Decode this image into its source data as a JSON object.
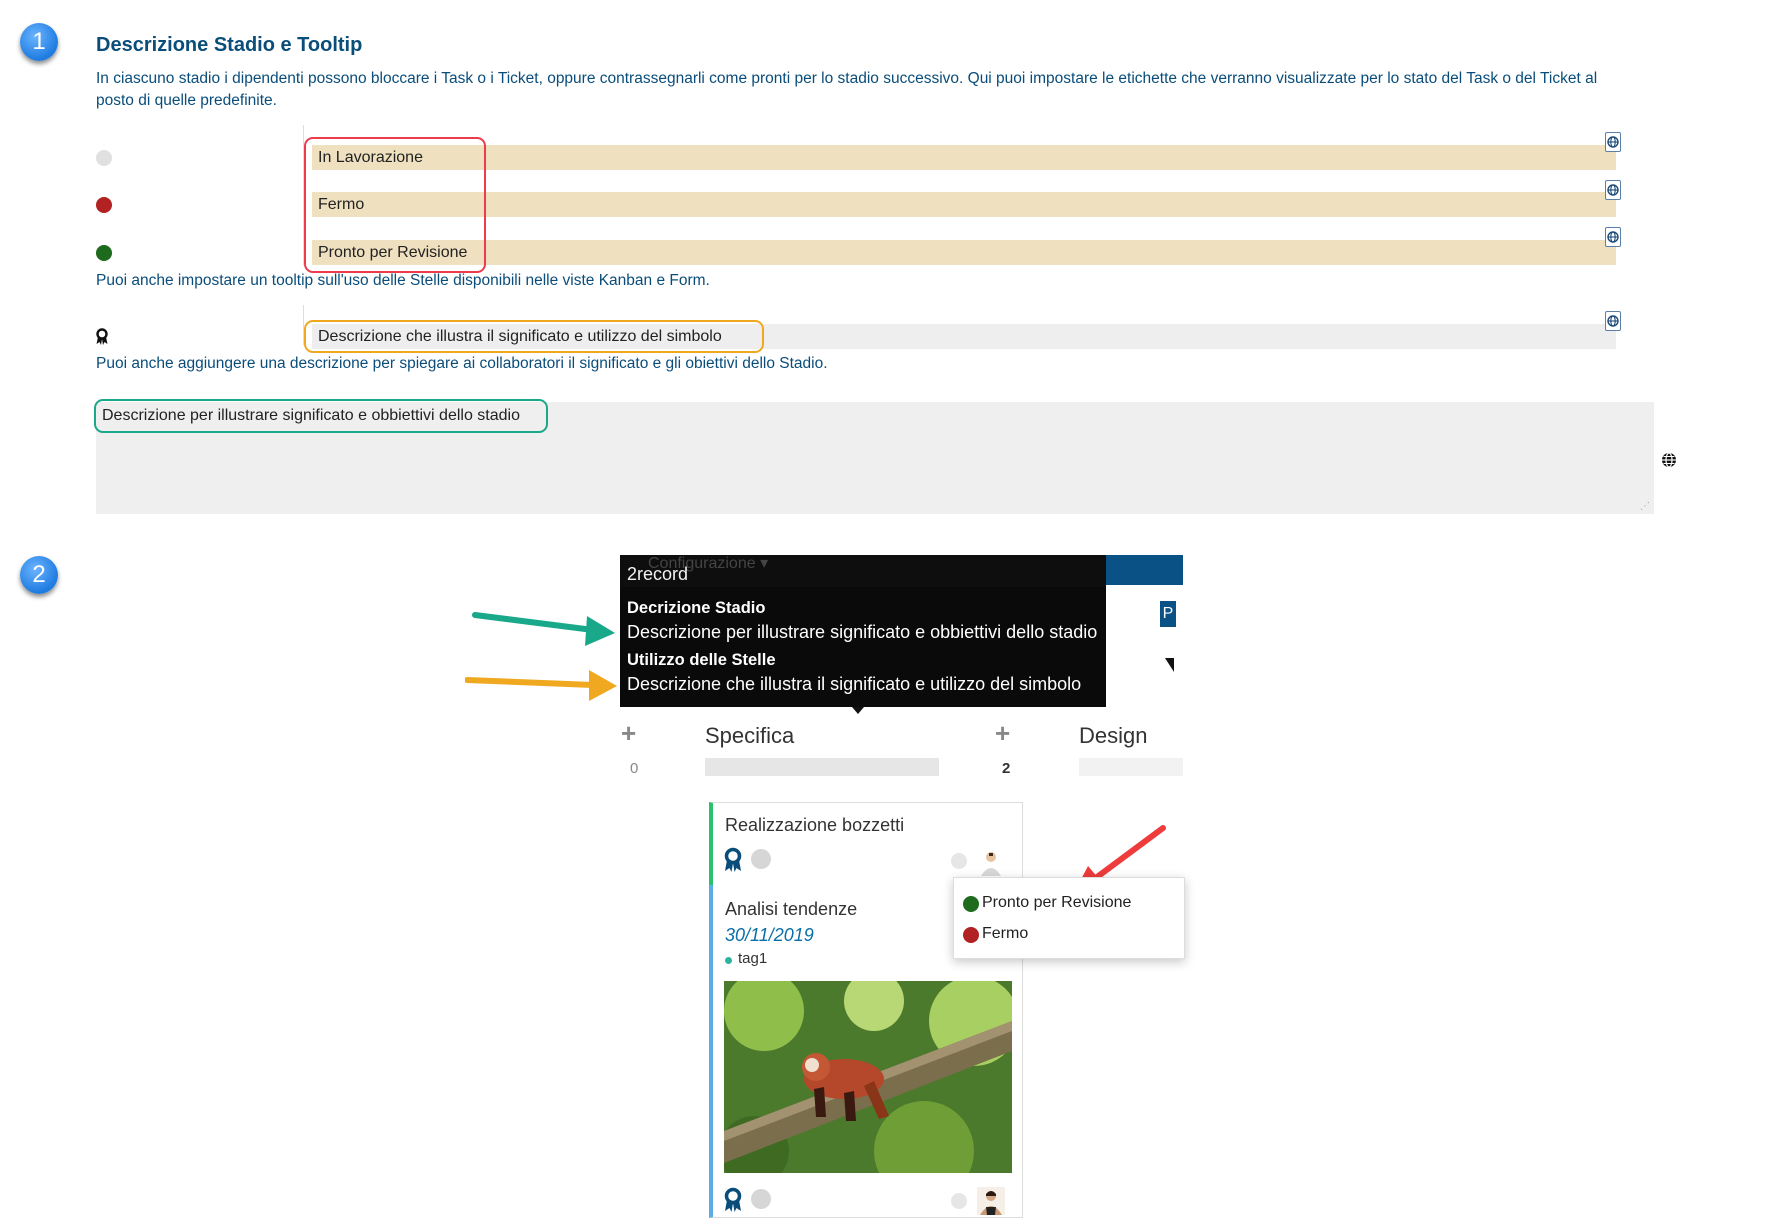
{
  "steps": {
    "one": "1",
    "two": "2"
  },
  "section1": {
    "title": "Descrizione Stadio e Tooltip",
    "intro_line1": "In ciascuno stadio i dipendenti possono bloccare i Task o i Ticket, oppure contrassegnarli come pronti per lo stadio successivo. Qui puoi impostare le etichette che verranno visualizzate per lo stato del Task o del Ticket al",
    "intro_line2": "posto di quelle predefinite.",
    "states": [
      {
        "label": "In Lavorazione",
        "color": "#e0e0e0"
      },
      {
        "label": "Fermo",
        "color": "#b22222"
      },
      {
        "label": "Pronto per Revisione",
        "color": "#1e6b1e"
      }
    ],
    "tooltip_hint": "Puoi anche impostare un tooltip sull'uso delle Stelle disponibili nelle viste Kanban e Form.",
    "star_tooltip_value": "Descrizione  che illustra il significato e utilizzo del simbolo",
    "description_hint": "Puoi anche aggiungere una descrizione per spiegare ai collaboratori il significato e gli obiettivi dello Stadio.",
    "description_value": "Descrizione per illustrare significato e obbiettivi dello stadio"
  },
  "section2": {
    "tooltip": {
      "faint_menu": "Configurazione ▾",
      "title": "2record",
      "stage_desc_label": "Decrizione Stadio",
      "stage_desc_value": "Descrizione per illustrare significato e obbiettivi dello stadio",
      "stars_label": "Utilizzo delle Stelle",
      "stars_value": "Descrizione che illustra il significato e utilizzo del simbolo"
    },
    "partial_button": "P",
    "kanban": {
      "columns": [
        {
          "name": "",
          "count": "0"
        },
        {
          "name": "Specifica",
          "count": "2"
        },
        {
          "name": "Design",
          "count": ""
        }
      ],
      "cards": [
        {
          "title": "Realizzazione bozzetti"
        },
        {
          "title": "Analisi tendenze",
          "date": "30/11/2019",
          "tag": "tag1"
        }
      ],
      "state_menu": [
        {
          "label": "Pronto per Revisione",
          "color": "#1e6b1e"
        },
        {
          "label": "Fermo",
          "color": "#b22222"
        }
      ]
    },
    "arrow_colors": {
      "teal": "#1aa88a",
      "orange": "#f0a820",
      "red": "#ee3b3b"
    }
  }
}
